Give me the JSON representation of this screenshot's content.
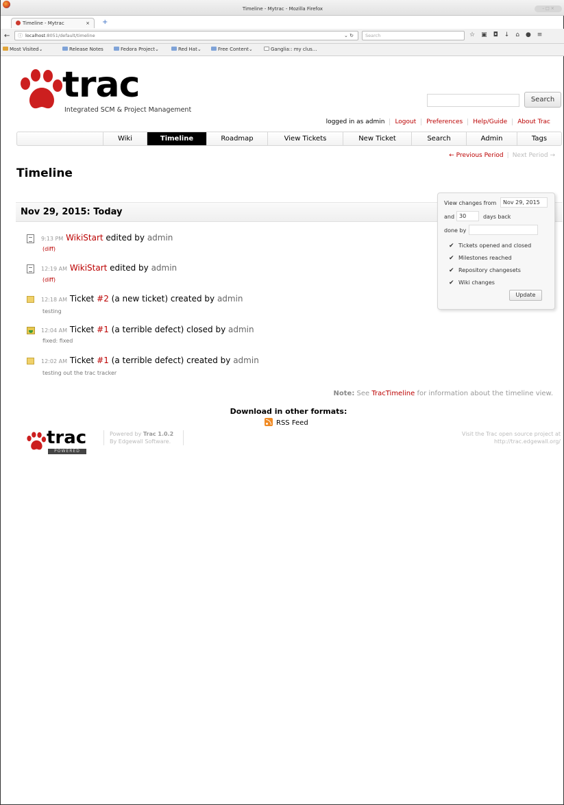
{
  "browser": {
    "window_title": "Timeline - Mytrac - Mozilla Firefox",
    "tab_title": "Timeline - Mytrac",
    "url_host": "localhost",
    "url_rest": ":8051/default/timeline",
    "search_placeholder": "Search",
    "bookmarks": [
      "Most Visited",
      "Release Notes",
      "Fedora Project",
      "Red Hat",
      "Free Content",
      "Ganglia:: my clus..."
    ]
  },
  "header": {
    "logo_text": "trac",
    "logo_tagline": "Integrated SCM & Project Management",
    "search_button": "Search"
  },
  "metanav": {
    "logged_in": "logged in as admin",
    "items": [
      "Logout",
      "Preferences",
      "Help/Guide",
      "About Trac"
    ]
  },
  "mainnav": [
    "Wiki",
    "Timeline",
    "Roadmap",
    "View Tickets",
    "New Ticket",
    "Search",
    "Admin",
    "Tags"
  ],
  "ctxtnav": {
    "prev": "← Previous Period",
    "next": "Next Period →"
  },
  "page_title": "Timeline",
  "day_header": "Nov 29, 2015: Today",
  "events": [
    {
      "time": "9:13 PM",
      "pre": "",
      "link": "WikiStart",
      "post": " edited by ",
      "author": "admin",
      "sub": "(diff)"
    },
    {
      "time": "12:19 AM",
      "pre": "",
      "link": "WikiStart",
      "post": " edited by ",
      "author": "admin",
      "sub": "(diff)"
    },
    {
      "time": "12:18 AM",
      "pre": "Ticket ",
      "link": "#2",
      "post": " (a new ticket) created by ",
      "author": "admin",
      "sub": "testing"
    },
    {
      "time": "12:04 AM",
      "pre": "Ticket ",
      "link": "#1",
      "post": " (a terrible defect) closed by ",
      "author": "admin",
      "sub": "fixed: fixed"
    },
    {
      "time": "12:02 AM",
      "pre": "Ticket ",
      "link": "#1",
      "post": " (a terrible defect) created by ",
      "author": "admin",
      "sub": "testing out the trac tracker"
    }
  ],
  "filters": {
    "from_label": "View changes from",
    "from_value": "Nov 29, 2015",
    "and_label": "and",
    "days_value": "30",
    "days_label": "days back",
    "doneby_label": "done by",
    "doneby_value": "",
    "checkboxes": [
      "Tickets opened and closed",
      "Milestones reached",
      "Repository changesets",
      "Wiki changes"
    ],
    "update_button": "Update"
  },
  "note": {
    "label": "Note:",
    "pre": " See ",
    "link": "TracTimeline",
    "post": " for information about the timeline view."
  },
  "altlinks": {
    "title": "Download in other formats:",
    "rss": "RSS Feed"
  },
  "footer": {
    "logo_text": "trac",
    "logo_badge": "POWERED",
    "powered_by": "Powered by ",
    "trac_version": "Trac 1.0.2",
    "by_line": "By Edgewall Software.",
    "visit_line1": "Visit the Trac open source project at",
    "visit_line2": "http://trac.edgewall.org/"
  },
  "colors": {
    "link": "#bb0000",
    "active_tab": "#000000",
    "paw": "#cc1f1f"
  }
}
